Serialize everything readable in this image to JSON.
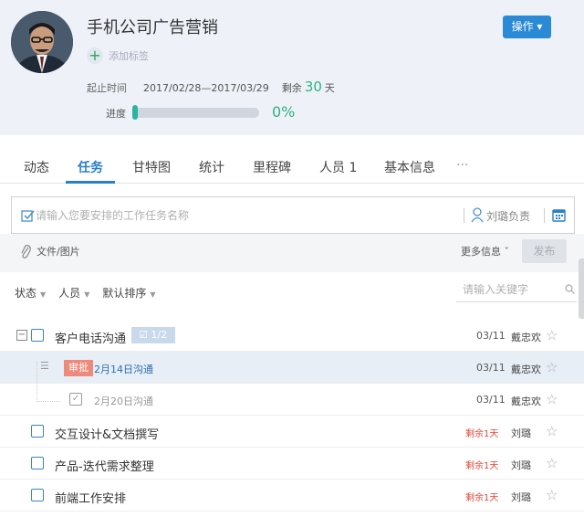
{
  "colors": {
    "accent": "#2a8ad6",
    "green": "#2db27d",
    "red": "#e0463a"
  },
  "project": {
    "title": "手机公司广告营销",
    "action_label": "操作 ▾",
    "add_tag_label": "添加标签",
    "start_label": "起止时间",
    "date_range": "2017/02/28—2017/03/29",
    "remaining_label": "剩余",
    "remaining_days": "30",
    "days_unit": "天",
    "progress_label": "进度",
    "progress": 0,
    "progress_text": "0%"
  },
  "tabs": [
    {
      "label": "动态"
    },
    {
      "label": "任务"
    },
    {
      "label": "甘特图"
    },
    {
      "label": "统计"
    },
    {
      "label": "里程碑"
    },
    {
      "label": "人员 1"
    },
    {
      "label": "基本信息"
    },
    {
      "label": "···"
    }
  ],
  "task_input": {
    "placeholder": "请输入您要安排的工作任务名称",
    "assignee": "刘璐负责",
    "attach_label": "文件/图片",
    "more_label": "更多信息 ˇ",
    "publish_label": "发布"
  },
  "filters": {
    "status": "状态",
    "people": "人员",
    "sort": "默认排序",
    "search_placeholder": "请输入关键字"
  },
  "tasks": [
    {
      "name": "客户电话沟通",
      "badge": "1/2",
      "date": "03/11",
      "person": "戴忠欢"
    },
    {
      "name": "2月14日沟通",
      "tag": "审批",
      "handle": "☰",
      "date": "03/11",
      "person": "戴忠欢"
    },
    {
      "name": "2月20日沟通",
      "check": "✓",
      "date": "03/11",
      "person": "戴忠欢"
    },
    {
      "name": "交互设计&文档撰写",
      "remain": "剩余1天",
      "person": "刘璐"
    },
    {
      "name": "产品-迭代需求整理",
      "remain": "剩余1天",
      "person": "刘璐"
    },
    {
      "name": "前端工作安排",
      "remain": "剩余1天",
      "person": "刘璐"
    }
  ],
  "star_glyph": "☆",
  "expander_glyph": "−"
}
